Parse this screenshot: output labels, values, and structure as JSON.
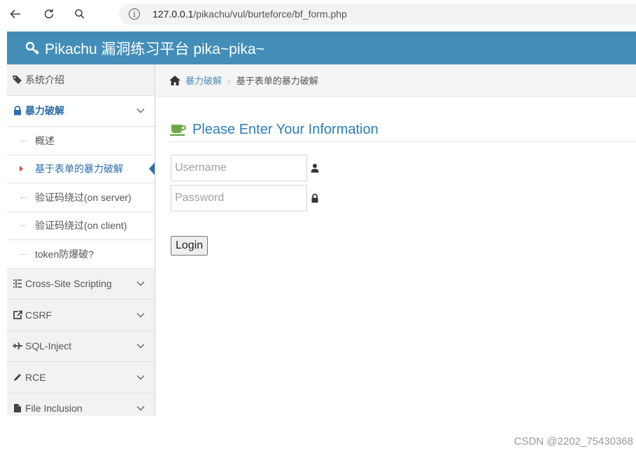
{
  "browser": {
    "url_host": "127.0.0.1",
    "url_path": "/pikachu/vul/burteforce/bf_form.php"
  },
  "header": {
    "title": "Pikachu 漏洞练习平台 pika~pika~"
  },
  "sidebar": {
    "items": [
      {
        "label": "系统介绍",
        "icon": "tags-icon"
      },
      {
        "label": "暴力破解",
        "icon": "lock-icon",
        "open": true
      },
      {
        "label": "Cross-Site Scripting",
        "icon": "list-icon"
      },
      {
        "label": "CSRF",
        "icon": "share-square-icon"
      },
      {
        "label": "SQL-Inject",
        "icon": "plane-icon"
      },
      {
        "label": "RCE",
        "icon": "pencil-icon"
      },
      {
        "label": "File Inclusion",
        "icon": "file-icon"
      }
    ],
    "subitems": [
      {
        "label": "概述"
      },
      {
        "label": "基于表单的暴力破解",
        "active": true
      },
      {
        "label": "验证码绕过(on server)"
      },
      {
        "label": "验证码绕过(on client)"
      },
      {
        "label": "token防爆破?"
      }
    ]
  },
  "breadcrumb": {
    "parent": "暴力破解",
    "current": "基于表单的暴力破解"
  },
  "form": {
    "title": "Please Enter Your Information",
    "username_placeholder": "Username",
    "password_placeholder": "Password",
    "login_label": "Login"
  },
  "colors": {
    "header_bg": "#438eb9",
    "accent": "#2b7dbc",
    "cup_icon": "#69aa46"
  },
  "watermark": "CSDN @2202_75430368"
}
